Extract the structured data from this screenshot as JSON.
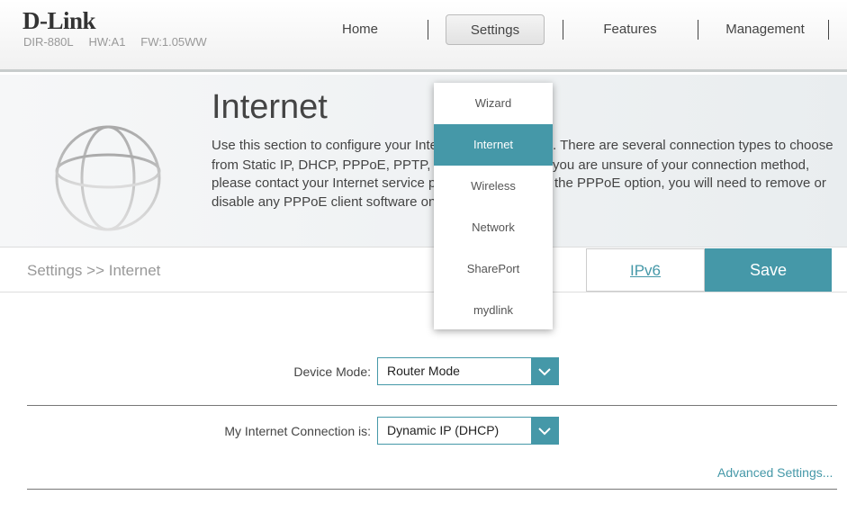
{
  "header": {
    "logo": "D-Link",
    "model": "DIR-880L",
    "hw": "HW:A1",
    "fw": "FW:1.05WW",
    "nav": [
      {
        "label": "Home"
      },
      {
        "label": "Settings"
      },
      {
        "label": "Features"
      },
      {
        "label": "Management"
      }
    ]
  },
  "hero": {
    "title": "Internet",
    "desc_lines": [
      {
        "left": "Use this section to configure your Inter",
        "right": ". There are several connection types to choose"
      },
      {
        "left": "from Static IP, DHCP, PPPoE, PPTP, L",
        "right": "you are unsure of your connection method,"
      },
      {
        "left": "please contact your Internet service pr",
        "right": "the PPPoE option, you will need to remove or"
      },
      {
        "left": "disable any PPPoE client software on",
        "right": ""
      }
    ]
  },
  "breadcrumb": "Settings >> Internet",
  "ipv6_label": "IPv6",
  "save_label": "Save",
  "form": {
    "device_mode": {
      "label": "Device Mode:",
      "value": "Router Mode"
    },
    "connection": {
      "label": "My Internet Connection is:",
      "value": "Dynamic IP (DHCP)"
    },
    "advanced_link": "Advanced Settings..."
  },
  "settings_menu": {
    "items": [
      {
        "label": "Wizard"
      },
      {
        "label": "Internet",
        "active": true
      },
      {
        "label": "Wireless"
      },
      {
        "label": "Network"
      },
      {
        "label": "SharePort"
      },
      {
        "label": "mydlink"
      }
    ]
  },
  "colors": {
    "accent": "#4598a8"
  }
}
